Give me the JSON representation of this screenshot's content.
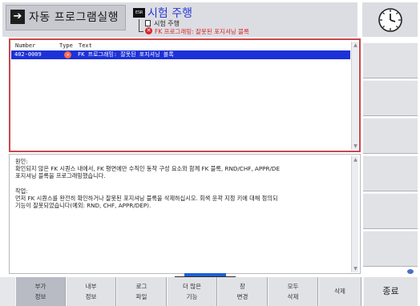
{
  "header": {
    "mode_label": "자동 프로그램실행",
    "mode_icon": "right-arrow-in-box-icon",
    "esr_icon_label": "ESR",
    "test_mode_title": "시험 주행",
    "sub_mode_label": "시험 주행",
    "sub_error_label": "FK 프로그래밍: 잘못된 포지셔닝 블록"
  },
  "clock": {
    "icon": "analog-clock-icon"
  },
  "error_table": {
    "columns": [
      "Number",
      "Type",
      "Text"
    ],
    "rows": [
      {
        "number": "402-0009",
        "type_icon": "error-x-icon",
        "text": "FK 프로그래밍: 잘못된 포지셔닝 블록"
      }
    ]
  },
  "info": {
    "cause_label": "원인:",
    "cause_line1": "확인되지 않은 FK 시퀀스 내에서, FK 평면에만 수직인 동작 구성 요소와 함께 FK 블록, RND/CHF, APPR/DE",
    "cause_line2": "포지셔닝 블록을 프로그래밍했습니다.",
    "action_label": "작업:",
    "action_line1": "먼저 FK 시퀀스를 완전히 확인하거나 잘못된 포지셔닝 블록을 삭제하십시오. 회색 윤곽 지정 키에 대해 정의되",
    "action_line2": "기능이 잘못되었습니다(예외: RND, CHF, APPR/DEP)."
  },
  "softkeys": [
    {
      "line1": "부가",
      "line2": "정보"
    },
    {
      "line1": "내부",
      "line2": "정보"
    },
    {
      "line1": "로그",
      "line2": "파일"
    },
    {
      "line1": "더 많은",
      "line2": "기능"
    },
    {
      "line1": "창",
      "line2": "변경"
    },
    {
      "line1": "모두",
      "line2": "삭제"
    },
    {
      "label": "삭제"
    }
  ],
  "end_key": "종료",
  "colors": {
    "accent_blue": "#1d31d8",
    "error_red": "#d8262b",
    "table_border": "#c6484c"
  }
}
